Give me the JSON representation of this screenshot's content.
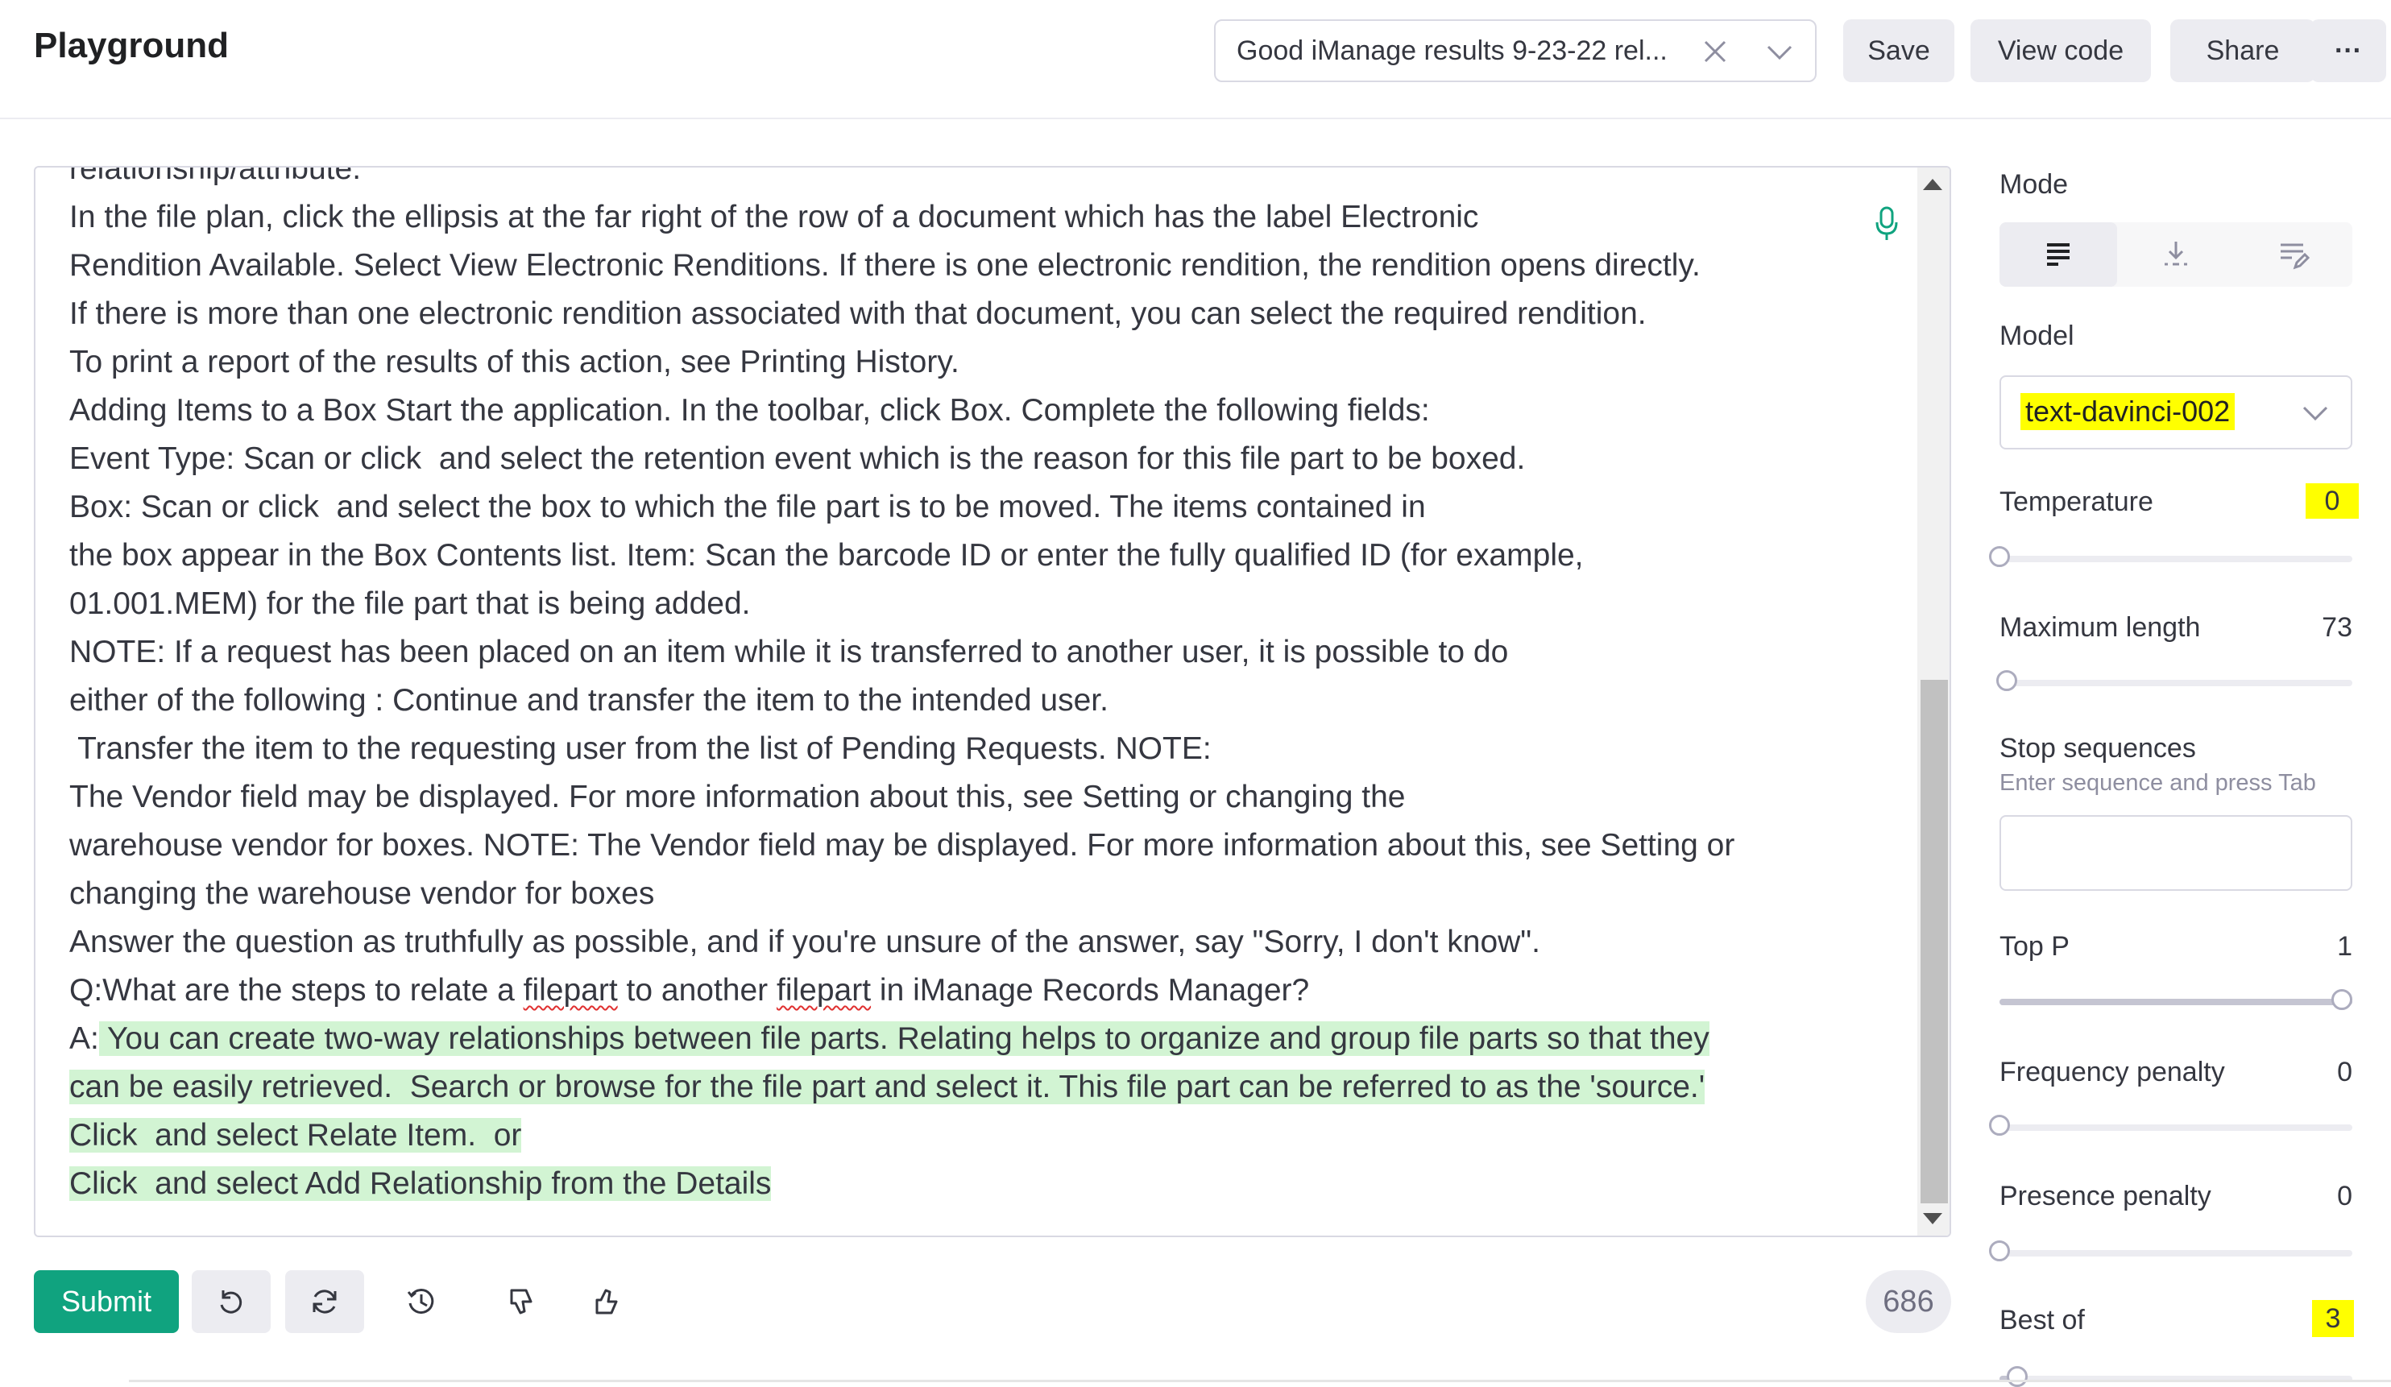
{
  "header": {
    "title": "Playground",
    "preset": "Good iManage results 9-23-22 rel...",
    "save": "Save",
    "view_code": "View code",
    "share": "Share",
    "more": "···"
  },
  "editor": {
    "lines": [
      {
        "pre": "relationship/attribute.",
        "link1": "",
        "mid": "",
        "link2": "",
        "post": "",
        "hl": ""
      },
      {
        "pre": "In the file plan, click the ellipsis at the far right of the row of a document which has the label Electronic",
        "link1": "",
        "mid": "",
        "link2": "",
        "post": "",
        "hl": ""
      },
      {
        "pre": "Rendition Available. Select View Electronic Renditions. If there is one electronic rendition, the rendition opens directly.",
        "link1": "",
        "mid": "",
        "link2": "",
        "post": "",
        "hl": ""
      },
      {
        "pre": "If there is more than one electronic rendition associated with that document, you can select the required rendition.",
        "link1": "",
        "mid": "",
        "link2": "",
        "post": "",
        "hl": ""
      },
      {
        "pre": "To print a report of the results of this action, see Printing History.",
        "link1": "",
        "mid": "",
        "link2": "",
        "post": "",
        "hl": ""
      },
      {
        "pre": "Adding Items to a Box Start the application. In the toolbar, click Box. Complete the following fields:",
        "link1": "",
        "mid": "",
        "link2": "",
        "post": "",
        "hl": ""
      },
      {
        "pre": "Event Type: Scan or click  and select the retention event which is the reason for this file part to be boxed.",
        "link1": "",
        "mid": "",
        "link2": "",
        "post": "",
        "hl": ""
      },
      {
        "pre": "Box: Scan or click  and select the box to which the file part is to be moved. The items contained in",
        "link1": "",
        "mid": "",
        "link2": "",
        "post": "",
        "hl": ""
      },
      {
        "pre": "the box appear in the Box Contents list. Item: Scan the barcode ID or enter the fully qualified ID (for example,",
        "link1": "",
        "mid": "",
        "link2": "",
        "post": "",
        "hl": ""
      },
      {
        "pre": "01.001.MEM) for the file part that is being added.",
        "link1": "",
        "mid": "",
        "link2": "",
        "post": "",
        "hl": ""
      },
      {
        "pre": "NOTE: If a request has been placed on an item while it is transferred to another user, it is possible to do",
        "link1": "",
        "mid": "",
        "link2": "",
        "post": "",
        "hl": ""
      },
      {
        "pre": "either of the following : Continue and transfer the item to the intended user.",
        "link1": "",
        "mid": "",
        "link2": "",
        "post": "",
        "hl": ""
      },
      {
        "pre": " Transfer the item to the requesting user from the list of Pending Requests. NOTE:",
        "link1": "",
        "mid": "",
        "link2": "",
        "post": "",
        "hl": ""
      },
      {
        "pre": "The Vendor field may be displayed. For more information about this, see Setting or changing the",
        "link1": "",
        "mid": "",
        "link2": "",
        "post": "",
        "hl": ""
      },
      {
        "pre": "warehouse vendor for boxes. NOTE: The Vendor field may be displayed. For more information about this, see Setting or",
        "link1": "",
        "mid": "",
        "link2": "",
        "post": "",
        "hl": ""
      },
      {
        "pre": "changing the warehouse vendor for boxes",
        "link1": "",
        "mid": "",
        "link2": "",
        "post": "",
        "hl": ""
      },
      {
        "pre": "Answer the question as truthfully as possible, and if you're unsure of the answer, say \"Sorry, I don't know\".",
        "link1": "",
        "mid": "",
        "link2": "",
        "post": "",
        "hl": ""
      },
      {
        "pre": "Q:What are the steps to relate a ",
        "link1": "filepart",
        "mid": " to another ",
        "link2": "filepart",
        "post": " in iManage Records Manager?",
        "hl": ""
      },
      {
        "pre": "A:",
        "link1": "",
        "mid": "",
        "link2": "",
        "post": "",
        "hl": " You can create two-way relationships between file parts. Relating helps to organize and group file parts so that they"
      },
      {
        "pre": "",
        "link1": "",
        "mid": "",
        "link2": "",
        "post": "",
        "hl": "can be easily retrieved.  Search or browse for the file part and select it. This file part can be referred to as the 'source.'"
      },
      {
        "pre": "",
        "link1": "",
        "mid": "",
        "link2": "",
        "post": "",
        "hl": "Click  and select Relate Item.  or"
      },
      {
        "pre": "",
        "link1": "",
        "mid": "",
        "link2": "",
        "post": "",
        "hl": "Click  and select Add Relationship from the Details"
      }
    ]
  },
  "toolbar": {
    "submit": "Submit",
    "token_count": "686"
  },
  "sidebar": {
    "mode_label": "Mode",
    "model_label": "Model",
    "model_value": "text-davinci-002",
    "temperature_label": "Temperature",
    "temperature_value": "0",
    "max_length_label": "Maximum length",
    "max_length_value": "73",
    "stop_label": "Stop sequences",
    "stop_hint": "Enter sequence and press Tab",
    "top_p_label": "Top P",
    "top_p_value": "1",
    "freq_label": "Frequency penalty",
    "freq_value": "0",
    "presence_label": "Presence penalty",
    "presence_value": "0",
    "best_of_label": "Best of",
    "best_of_value": "3",
    "sliders": {
      "temperature": 0,
      "max_length": 0.02,
      "top_p": 1,
      "frequency": 0,
      "presence": 0,
      "best_of": 0.05
    }
  },
  "colors": {
    "accent": "#10a37f",
    "highlight_green": "#d2f4d3",
    "highlight_yellow": "#ffff00"
  }
}
